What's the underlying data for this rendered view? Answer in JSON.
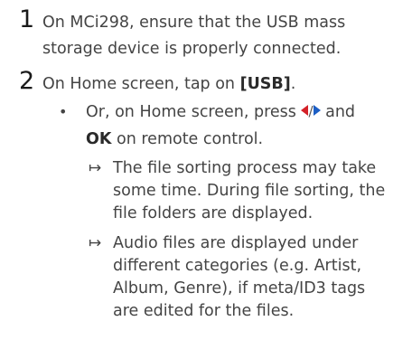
{
  "steps": [
    {
      "number": "1",
      "lines": [
        "On MCi298, ensure that the USB mass",
        "storage device is properly connected."
      ]
    },
    {
      "number": "2",
      "line1_prefix": "On Home screen, tap on ",
      "line1_bold": "[USB]",
      "line1_suffix": ".",
      "bullet": "•",
      "sub_line1_prefix": "Or, on Home screen, press ",
      "sub_line1_suffix": " and",
      "nav_icon": "left-right-navigation-icon",
      "sub_line2_bold": "OK",
      "sub_line2_suffix": " on remote control.",
      "results": [
        {
          "arrow": "↦",
          "lines": [
            "The file sorting process may take",
            "some time. During file sorting, the",
            "file folders are displayed."
          ]
        },
        {
          "arrow": "↦",
          "lines": [
            "Audio files are displayed under",
            "different categories (e.g. Artist,",
            "Album, Genre), if meta/ID3 tags",
            "are edited for the files."
          ]
        }
      ]
    }
  ],
  "colors": {
    "text": "#444444",
    "left_arrow": "#d42128",
    "right_arrow": "#1d5fc5"
  }
}
